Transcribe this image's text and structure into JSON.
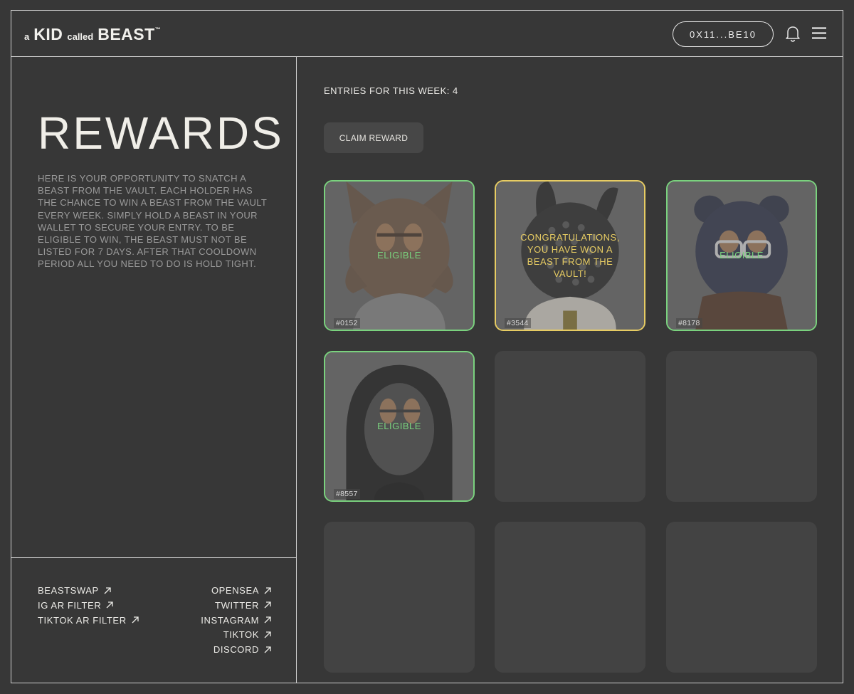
{
  "header": {
    "logo": {
      "a": "a",
      "kid": "KID",
      "called": "called",
      "beast": "BEAST",
      "tm": "™"
    },
    "wallet_label": "0X11...BE10",
    "bell_icon": "bell-icon",
    "menu_icon": "hamburger-menu-icon"
  },
  "left": {
    "title": "REWARDS",
    "description": "HERE IS YOUR OPPORTUNITY TO SNATCH A BEAST FROM THE VAULT. EACH HOLDER HAS THE CHANCE TO WIN A BEAST FROM THE VAULT EVERY WEEK. SIMPLY HOLD A BEAST IN YOUR WALLET TO SECURE YOUR ENTRY. TO BE ELIGIBLE TO WIN, THE BEAST MUST NOT BE LISTED FOR 7 DAYS. AFTER THAT COOLDOWN PERIOD ALL YOU NEED TO DO IS HOLD TIGHT.",
    "links_left": [
      "BEASTSWAP",
      "IG AR FILTER",
      "TIKTOK AR FILTER"
    ],
    "links_right": [
      "OPENSEA",
      "TWITTER",
      "INSTAGRAM",
      "TIKTOK",
      "DISCORD"
    ],
    "link_icon": "arrow-up-right-icon"
  },
  "main": {
    "entries_label": "ENTRIES FOR THIS WEEK: 4",
    "claim_button": "CLAIM REWARD",
    "cards": [
      {
        "id": "#0152",
        "status": "ELIGIBLE",
        "state": "eligible"
      },
      {
        "id": "#3544",
        "status": "CONGRATULATIONS, YOU HAVE WON A BEAST FROM THE VAULT!",
        "state": "won"
      },
      {
        "id": "#8178",
        "status": "ELIGIBLE",
        "state": "eligible"
      },
      {
        "id": "#8557",
        "status": "ELIGIBLE",
        "state": "eligible"
      }
    ],
    "empty_slots": 5
  },
  "colors": {
    "background": "#373737",
    "eligible": "#7ad27e",
    "won": "#e7cc63",
    "empty_slot": "#434343"
  }
}
